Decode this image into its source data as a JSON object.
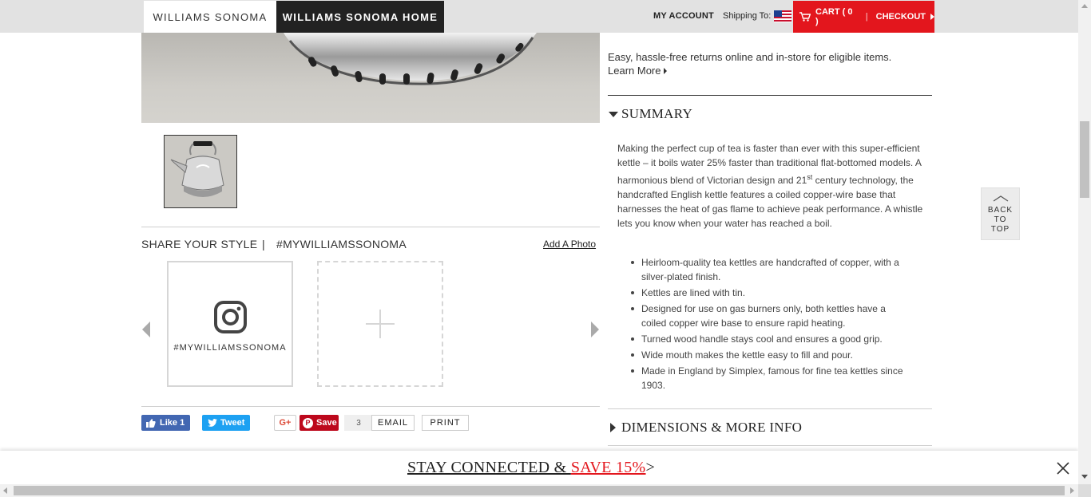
{
  "header": {
    "tab_ws": "WILLIAMS SONOMA",
    "tab_ws_home": "WILLIAMS SONOMA HOME",
    "my_account": "MY ACCOUNT",
    "shipping_to": "Shipping To:",
    "cart": "CART ( 0 )",
    "separator": "|",
    "checkout": "CHECKOUT"
  },
  "share": {
    "title": "SHARE YOUR STYLE",
    "separator": "|",
    "hashtag": "#MYWILLIAMSSONOMA",
    "add_photo": "Add A Photo",
    "card_tag": "#MYWILLIAMSSONOMA"
  },
  "social": {
    "fb_label": "Like 1",
    "tw_label": "Tweet",
    "gplus_label": "G+",
    "pin_label": "Save",
    "pin_count": "3",
    "email_label": "EMAIL",
    "print_label": "PRINT"
  },
  "returns": {
    "text": "Easy, hassle-free returns online and in-store for eligible items.",
    "learn_more": "Learn More"
  },
  "summary": {
    "heading": "SUMMARY",
    "para_1": "Making the perfect cup of tea is faster than ever with this super-efficient kettle – it boils water 25% faster than traditional flat-bottomed models. A harmonious blend of Victorian design and 21",
    "para_sup": "st",
    "para_2": " century technology, the handcrafted English kettle features a coiled copper-wire base that harnesses the heat of gas flame to achieve peak performance. A whistle lets you know when your water has reached a boil.",
    "bullets": [
      "Heirloom-quality tea kettles are handcrafted of copper, with a silver-plated finish.",
      "Kettles are lined with tin.",
      "Designed for use on gas burners only, both kettles have a coiled copper wire base to ensure rapid heating.",
      "Turned wood handle stays cool and ensures a good grip.",
      "Wide mouth makes the kettle easy to fill and pour.",
      "Made in England by Simplex, famous for fine tea kettles since 1903."
    ]
  },
  "dimensions": {
    "heading": "DIMENSIONS & MORE INFO"
  },
  "back_to_top": {
    "line1": "BACK",
    "line2": "TO",
    "line3": "TOP"
  },
  "banner": {
    "part1": "STAY CONNECTED & ",
    "part2": "SAVE 15%",
    "arrow": ">"
  },
  "colors": {
    "brand_red": "#e3161d",
    "dark": "#222222",
    "facebook": "#4267b2",
    "twitter": "#1da1f2",
    "pinterest": "#bd081c"
  }
}
